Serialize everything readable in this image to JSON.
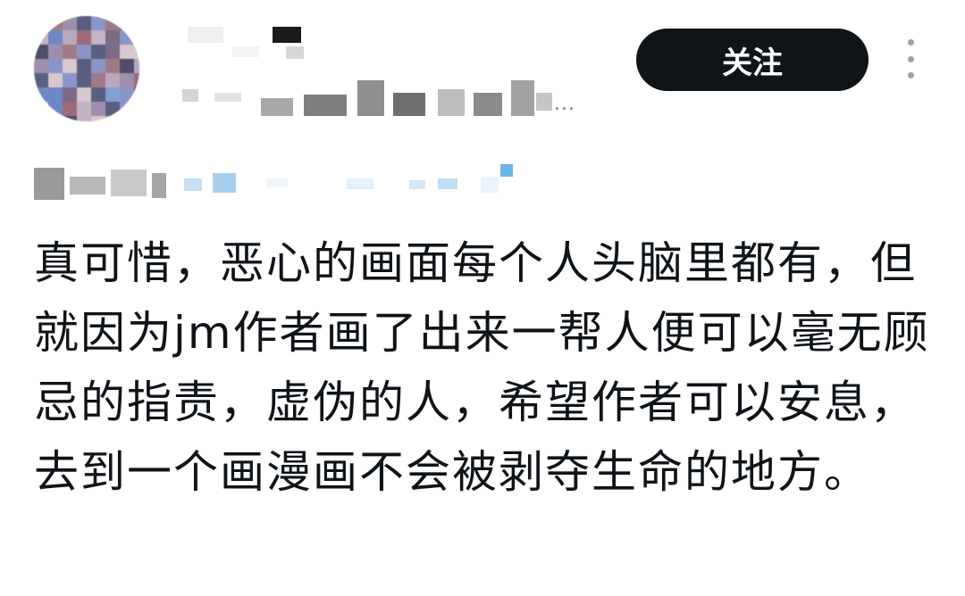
{
  "post": {
    "author_avatar": "avatar-pixelated",
    "follow_label": "关注",
    "more_icon": "vertical-ellipsis-icon",
    "handle_ellipsis": "...",
    "text": "真可惜，恶心的画面每个人头脑里都有，但就因为jm作者画了出来一帮人便可以毫无顾忌的指责，虚伪的人，希望作者可以安息，去到一个画漫画不会被剥夺生命的地方。"
  },
  "colors": {
    "follow_button_bg": "#0f1419",
    "follow_button_text": "#ffffff",
    "text": "#0f1419",
    "more_icon": "#9aa4ac"
  }
}
